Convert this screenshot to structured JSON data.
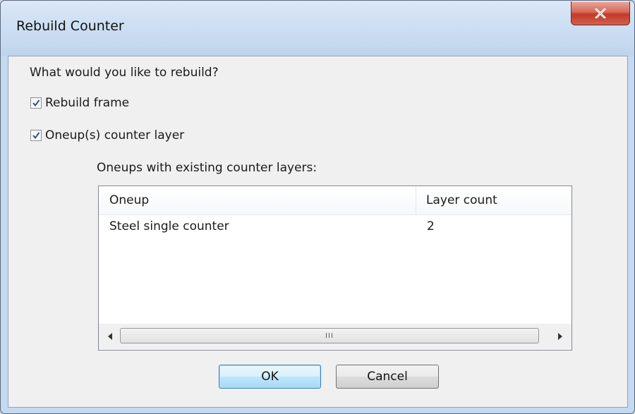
{
  "window": {
    "title": "Rebuild Counter"
  },
  "prompt": "What would you like to rebuild?",
  "options": [
    {
      "label": "Rebuild frame",
      "checked": true
    },
    {
      "label": "Oneup(s) counter layer",
      "checked": true
    }
  ],
  "list": {
    "caption": "Oneups with existing counter layers:",
    "columns": [
      "Oneup",
      "Layer count"
    ],
    "rows": [
      {
        "oneup": "Steel single counter",
        "layer_count": "2"
      }
    ],
    "scroll_grip": "III"
  },
  "buttons": {
    "ok": "OK",
    "cancel": "Cancel"
  },
  "icons": {
    "close": "close-icon",
    "check": "checkmark-icon",
    "left": "scroll-left-arrow-icon",
    "right": "scroll-right-arrow-icon"
  }
}
